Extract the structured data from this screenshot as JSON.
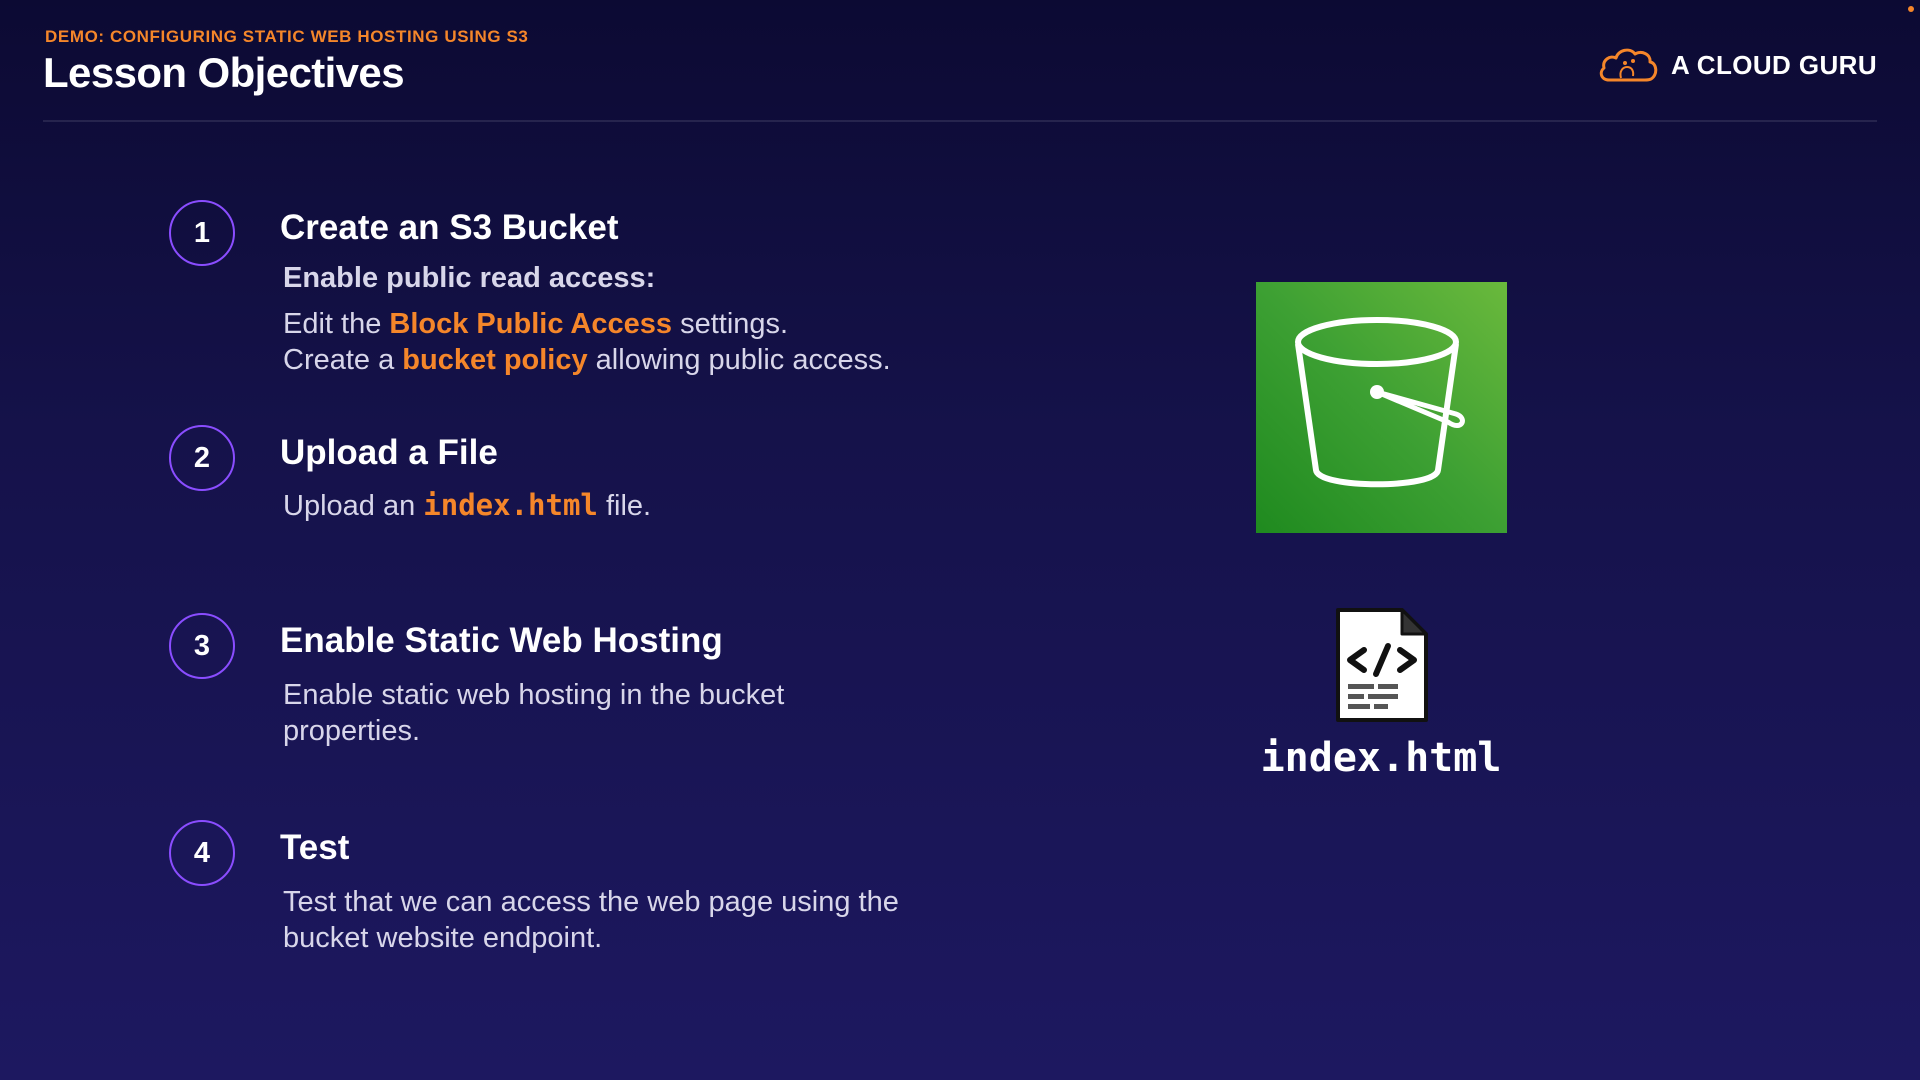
{
  "header": {
    "kicker": "DEMO: CONFIGURING STATIC WEB HOSTING USING S3",
    "title": "Lesson Objectives",
    "brand": "A CLOUD GURU",
    "brand_icon": "cloud-logo-icon"
  },
  "colors": {
    "accent": "#f5862a",
    "ring": "#8a4dff",
    "s3_green": "#3da033",
    "background": "#15124a"
  },
  "steps": [
    {
      "number": "1",
      "title": "Create an S3 Bucket",
      "subtitle": "Enable public read access:",
      "line1": {
        "pre": "Edit the ",
        "hl": "Block Public Access",
        "post": " settings."
      },
      "line2": {
        "pre": "Create a ",
        "hl": "bucket policy",
        "post": " allowing public access."
      }
    },
    {
      "number": "2",
      "title": "Upload a File",
      "line1": {
        "pre": "Upload an ",
        "code": "index.html",
        "post": " file."
      }
    },
    {
      "number": "3",
      "title": "Enable Static Web Hosting",
      "body": "Enable static web hosting in the bucket properties."
    },
    {
      "number": "4",
      "title": "Test",
      "body": "Test that we can access the web page using the bucket website endpoint."
    }
  ],
  "illustrations": {
    "bucket_icon": "s3-bucket-icon",
    "file_icon": "html-file-icon",
    "file_label": "index.html"
  }
}
